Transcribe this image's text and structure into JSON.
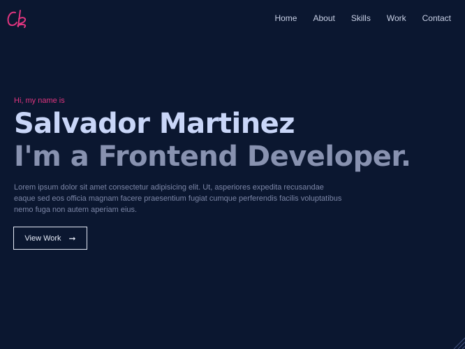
{
  "logo": {
    "icon": "cb-signature-logo-icon",
    "color": "#e0357f"
  },
  "nav": {
    "items": [
      {
        "label": "Home"
      },
      {
        "label": "About"
      },
      {
        "label": "Skills"
      },
      {
        "label": "Work"
      },
      {
        "label": "Contact"
      }
    ]
  },
  "hero": {
    "greeting": "Hi, my name is",
    "name": "Salvador Martinez",
    "role": "I'm a Frontend Developer.",
    "bio": "Lorem ipsum dolor sit amet consectetur adipisicing elit. Ut, asperiores expedita recusandae eaque sed eos officia magnam facere praesentium fugiat cumque perferendis facilis voluptatibus nemo fuga non autem aperiam eius.",
    "cta_label": "View Work",
    "cta_icon": "arrow-right-icon"
  },
  "colors": {
    "background": "#0b1730",
    "accent": "#e0357f",
    "heading": "#c9d6f8",
    "subheading": "#8892b0",
    "body_text": "#7c86a6"
  }
}
